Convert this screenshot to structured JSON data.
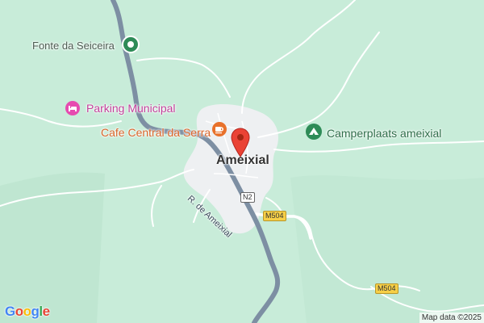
{
  "colors": {
    "background": "#c8ecd9",
    "town_fill": "#eef0f2",
    "river": "#7d8fa3",
    "road": "#ffffff",
    "marker_red": "#ea4335",
    "poi_pink": "#e64bb0",
    "poi_green": "#2e8b57",
    "poi_orange": "#e8712b"
  },
  "labels": {
    "fonte": "Fonte da Seiceira",
    "parking": "Parking Municipal",
    "cafe": "Cafe Central da Serra",
    "camper": "Camperplaats ameixial",
    "town": "Ameixial",
    "street": "R. de Ameixial"
  },
  "shields": {
    "n2": "N2",
    "m504_a": "M504",
    "m504_b": "M504"
  },
  "icons": {
    "fonte": "water-fountain-icon",
    "parking": "lodging-icon",
    "cafe": "coffee-icon",
    "camper": "campground-icon",
    "marker": "location-pin-icon"
  },
  "google_logo": {
    "g1": "G",
    "o1": "o",
    "o2": "o",
    "g2": "g",
    "l": "l",
    "e": "e"
  },
  "attribution": "Map data ©2025"
}
